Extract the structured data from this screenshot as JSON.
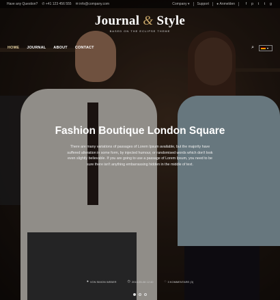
{
  "topbar": {
    "question": "Have any Question?",
    "phone": "+41 123 456 555",
    "email": "info@company.com",
    "company": "Company",
    "support": "Support",
    "account": "Anmelden"
  },
  "logo": {
    "title_left": "Journal",
    "amp": "&",
    "title_right": "Style",
    "subtitle": "BASED ON THE ECLIPSE THEME"
  },
  "nav": {
    "items": [
      "HOME",
      "JOURNAL",
      "ABOUT",
      "CONTACT"
    ]
  },
  "hero": {
    "title": "Fashion Boutique London Square",
    "text": "There are many variations of passages of Lorem Ipsum available, but the majority have suffered alteration in some form, by injected humour, or randomised words which don't look even slightly believable. If you are going to use a passage of Lorem Ipsum, you need to be sure there isn't anything embarrassing hidden in the middle of text.",
    "author": "VON SIMON WEBER",
    "date": "2016-05-08 12:40",
    "comments": "3 KOMMENTARE (3)"
  },
  "slider": {
    "count": 3,
    "active": 1
  }
}
